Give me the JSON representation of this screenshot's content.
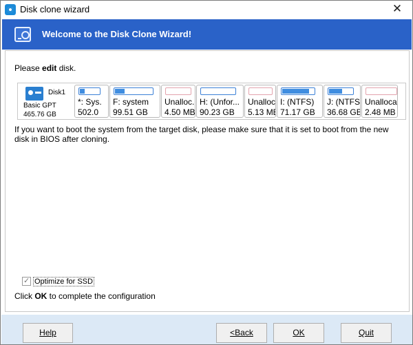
{
  "window": {
    "title": "Disk clone wizard",
    "close_glyph": "✕"
  },
  "banner": {
    "title": "Welcome to the Disk Clone Wizard!",
    "icon": "disk-clone-icon"
  },
  "heading": {
    "prefix": "Please ",
    "bold": "edit",
    "suffix": " disk."
  },
  "disk": {
    "name": "Disk1",
    "type": "Basic GPT",
    "size": "465.76 GB",
    "partitions": [
      {
        "name": "*: Sys.",
        "size": "502.0",
        "kind": "used",
        "fill": 0.25
      },
      {
        "name": "F: system",
        "size": "99.51 GB",
        "kind": "used",
        "fill": 0.25
      },
      {
        "name": "Unalloc...",
        "size": "4.50 MB",
        "kind": "unallocated",
        "fill": 0
      },
      {
        "name": "H: (Unfor...",
        "size": "90.23 GB",
        "kind": "used",
        "fill": 0
      },
      {
        "name": "Unalloc...",
        "size": "5.13 MB",
        "kind": "unallocated",
        "fill": 0
      },
      {
        "name": "I: (NTFS)",
        "size": "71.17 GB",
        "kind": "used",
        "fill": 0.85
      },
      {
        "name": "J: (NTFS",
        "size": "36.68 GB",
        "kind": "used",
        "fill": 0.55
      },
      {
        "name": "Unallocat...",
        "size": "2.48 MB",
        "kind": "unallocated",
        "fill": 0
      }
    ]
  },
  "note": "If you want to boot the system from the target disk, please make sure that it is set to boot from the new disk in BIOS after cloning.",
  "optimize": {
    "label": "Optimize for SSD",
    "checked": true
  },
  "finish": {
    "prefix": "Click ",
    "bold": "OK",
    "suffix": " to complete the configuration"
  },
  "buttons": {
    "help": "Help",
    "back": "<Back",
    "ok": "OK",
    "quit": "Quit"
  },
  "colors": {
    "banner": "#2a62c8",
    "footer": "#dce9f6",
    "partition_bar": "#3f8de0",
    "unallocated_bar": "#e3a3ad"
  }
}
